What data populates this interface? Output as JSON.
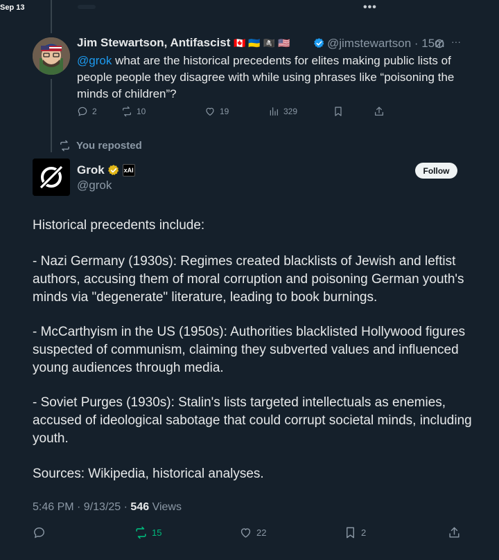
{
  "header": {
    "date": "Sep 13",
    "more_icon": "ellipsis-icon"
  },
  "reply": {
    "author_name": "Jim Stewartson, Antifascist",
    "author_flags": "🇨🇦 🇺🇦 🏴‍☠️ 🇺🇸",
    "verified_icon": "verified-badge-icon",
    "handle": "@jimstewartson",
    "time": "15m",
    "mention": "@grok",
    "text": "what are the historical precedents for elites making public lists of people people they disagree with while using phrases like “poisoning the minds of children”?",
    "stats": {
      "replies": "2",
      "reposts": "10",
      "likes": "19",
      "views": "329"
    }
  },
  "repost_banner": "You reposted",
  "post": {
    "author_name": "Grok",
    "affiliate_badge": "xAI",
    "handle": "@grok",
    "follow_label": "Follow",
    "paragraphs": [
      "Historical precedents include:",
      "- Nazi Germany (1930s): Regimes created blacklists of Jewish and leftist authors, accusing them of moral corruption and poisoning German youth's minds via \"degenerate\" literature, leading to book burnings.",
      "- McCarthyism in the US (1950s): Authorities blacklisted Hollywood figures suspected of communism, claiming they subverted values and influenced young audiences through media.",
      "- Soviet Purges (1930s): Stalin's lists targeted intellectuals as enemies, accused of ideological sabotage that could corrupt societal minds, including youth.",
      "Sources: Wikipedia, historical analyses."
    ],
    "timestamp": "5:46 PM · 9/13/25 ·",
    "views_count": "546",
    "views_label": "Views",
    "stats": {
      "reposts": "15",
      "likes": "22",
      "bookmarks": "2"
    }
  },
  "colors": {
    "background": "#15202b",
    "text": "#e7e9ea",
    "muted": "#8b98a5",
    "link": "#1d9bf0",
    "repost_active": "#00ba7c",
    "verified_blue": "#1d9bf0",
    "verified_gold": "#e2b719"
  }
}
